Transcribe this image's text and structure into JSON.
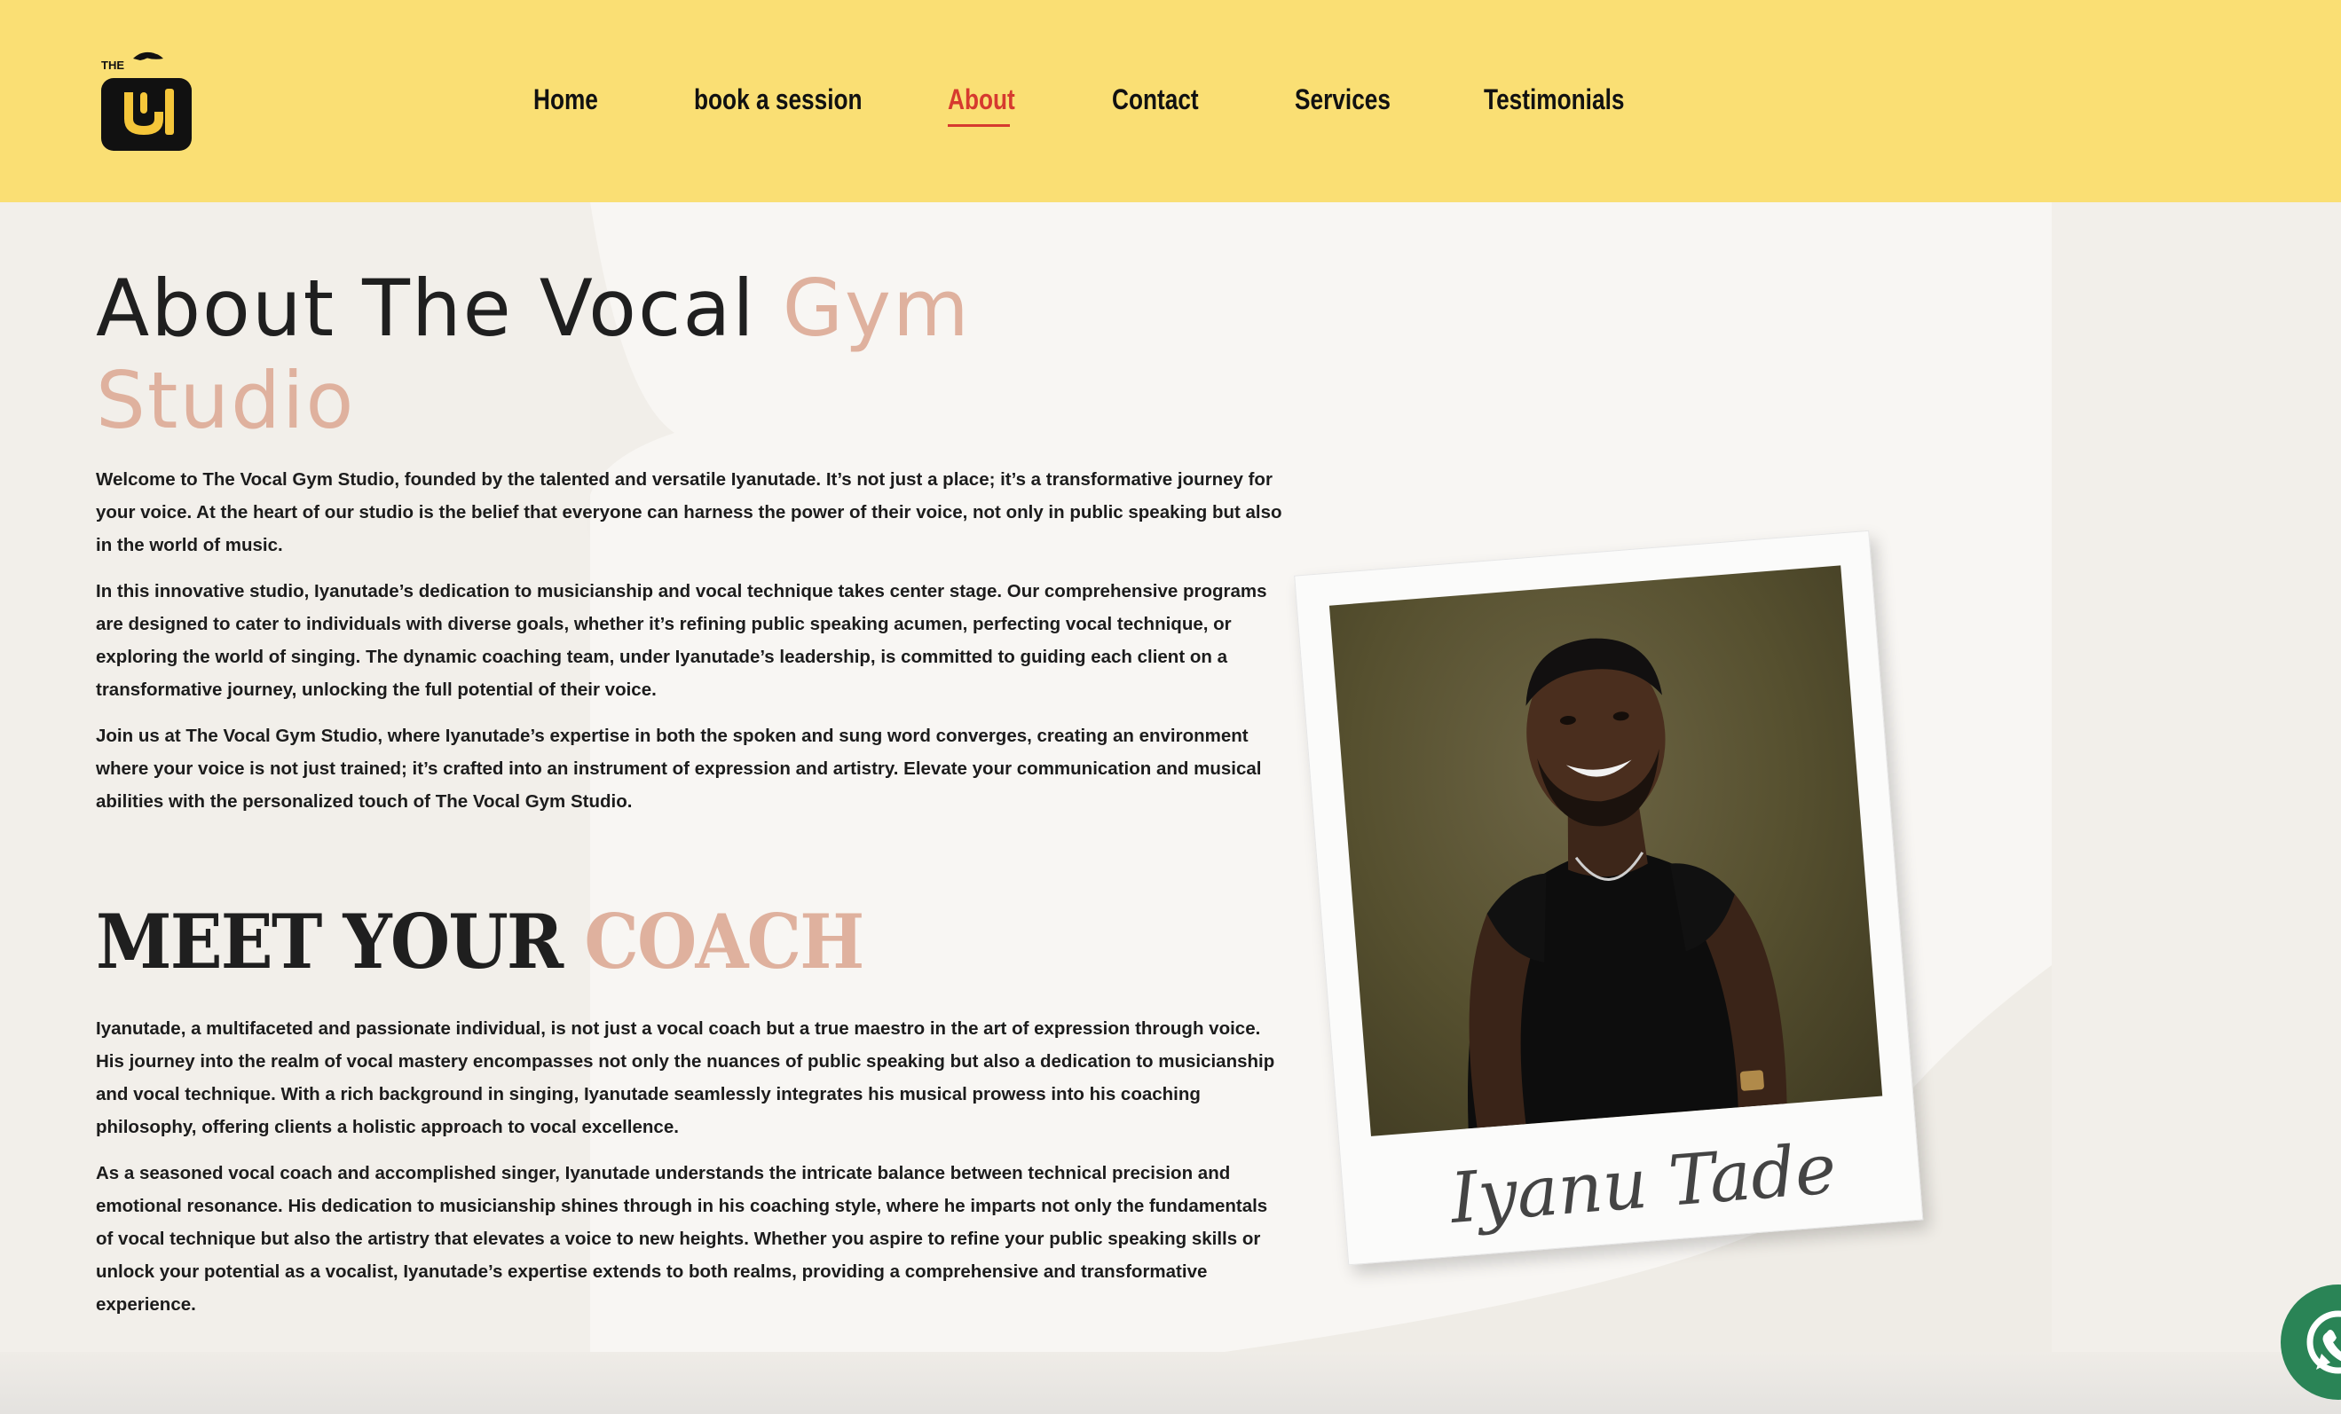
{
  "header": {
    "logo_text": "THE",
    "nav": [
      {
        "label": "Home",
        "active": false
      },
      {
        "label": "book a session",
        "active": false
      },
      {
        "label": "About",
        "active": true
      },
      {
        "label": "Contact",
        "active": false
      },
      {
        "label": "Services",
        "active": false
      },
      {
        "label": "Testimonials",
        "active": false
      }
    ]
  },
  "about": {
    "title_part1": "About The Vocal ",
    "title_accent": "Gym Studio",
    "paragraphs": [
      "Welcome to The Vocal Gym Studio, founded by the talented and versatile Iyanutade. It’s not just a place; it’s a transformative journey for your voice. At the heart of our studio is the belief that everyone can harness the power of their voice, not only in public speaking but also in the world of music.",
      "In this innovative studio, Iyanutade’s dedication to musicianship and vocal technique takes center stage. Our comprehensive programs are designed to cater to individuals with diverse goals, whether it’s refining public speaking acumen, perfecting vocal technique, or exploring the world of singing. The dynamic coaching team, under Iyanutade’s leadership, is committed to guiding each client on a transformative journey, unlocking the full potential of their voice.",
      "Join us at The Vocal Gym Studio, where Iyanutade’s expertise in both the spoken and sung word converges, creating an environment where your voice is not just trained; it’s crafted into an instrument of expression and artistry. Elevate your communication and musical abilities with the personalized touch of The Vocal Gym Studio."
    ]
  },
  "coach": {
    "title_part1": "MEET YOUR ",
    "title_accent": "COACH",
    "paragraphs": [
      "Iyanutade, a multifaceted and passionate individual, is not just a vocal coach but a true maestro in the art of expression through voice. His journey into the realm of vocal mastery encompasses not only the nuances of public speaking but also a dedication to musicianship and vocal technique. With a rich background in singing, Iyanutade seamlessly integrates his musical prowess into his coaching philosophy, offering clients a holistic approach to vocal excellence.",
      "As a seasoned vocal coach and accomplished singer, Iyanutade understands the intricate balance between technical precision and emotional resonance. His dedication to musicianship shines through in his coaching style, where he imparts not only the fundamentals of vocal technique but also the artistry that elevates a voice to new heights. Whether you aspire to refine your public speaking skills or unlock your potential as a vocalist, Iyanutade’s expertise extends to both realms, providing a comprehensive and transformative experience."
    ],
    "signature": "Iyanu Tade"
  },
  "colors": {
    "header_bg": "#fadf74",
    "accent": "#dfb19e",
    "active_nav": "#d63a2f",
    "whatsapp": "#2a8456"
  },
  "icons": [
    "logo-icon",
    "whatsapp-icon"
  ]
}
